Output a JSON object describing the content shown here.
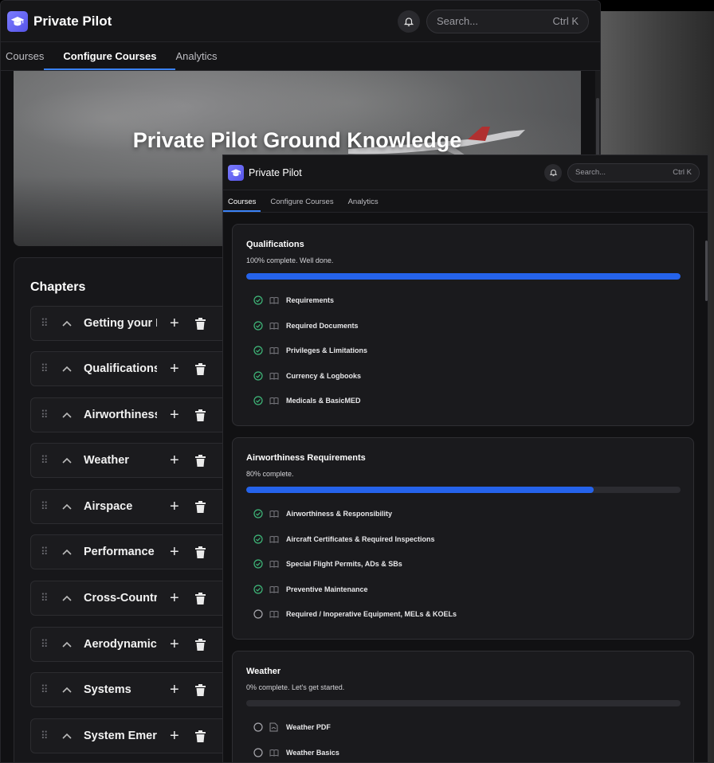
{
  "back_window": {
    "app_title": "Private Pilot",
    "search_placeholder": "Search...",
    "search_shortcut": "Ctrl K",
    "tabs": [
      {
        "label": "Courses",
        "active": false
      },
      {
        "label": "Configure Courses",
        "active": true
      },
      {
        "label": "Analytics",
        "active": false
      }
    ],
    "hero_title": "Private Pilot Ground Knowledge",
    "chapters_heading": "Chapters",
    "chapters": [
      "Getting your P",
      "Qualifications",
      "Airworthiness",
      "Weather",
      "Airspace",
      "Performance &",
      "Cross-Country",
      "Aerodynamics",
      "Systems",
      "System Emerg"
    ]
  },
  "front_window": {
    "app_title": "Private Pilot",
    "search_placeholder": "Search...",
    "search_shortcut": "Ctrl K",
    "tabs": [
      {
        "label": "Courses",
        "active": true
      },
      {
        "label": "Configure Courses",
        "active": false
      },
      {
        "label": "Analytics",
        "active": false
      }
    ],
    "courses": [
      {
        "title": "Qualifications",
        "status": "100% complete. Well done.",
        "progress_percent": 100,
        "lessons": [
          {
            "label": "Requirements",
            "done": true,
            "icon": "book-icon"
          },
          {
            "label": "Required Documents",
            "done": true,
            "icon": "book-icon"
          },
          {
            "label": "Privileges & Limitations",
            "done": true,
            "icon": "book-icon"
          },
          {
            "label": "Currency & Logbooks",
            "done": true,
            "icon": "book-icon"
          },
          {
            "label": "Medicals & BasicMED",
            "done": true,
            "icon": "book-icon"
          }
        ]
      },
      {
        "title": "Airworthiness Requirements",
        "status": "80% complete.",
        "progress_percent": 80,
        "lessons": [
          {
            "label": "Airworthiness & Responsibility",
            "done": true,
            "icon": "book-icon"
          },
          {
            "label": "Aircraft Certificates & Required Inspections",
            "done": true,
            "icon": "book-icon"
          },
          {
            "label": "Special Flight Permits, ADs & SBs",
            "done": true,
            "icon": "book-icon"
          },
          {
            "label": "Preventive Maintenance",
            "done": true,
            "icon": "book-icon"
          },
          {
            "label": "Required / Inoperative Equipment, MELs & KOELs",
            "done": false,
            "icon": "book-icon"
          }
        ]
      },
      {
        "title": "Weather",
        "status": "0% complete. Let's get started.",
        "progress_percent": 0,
        "lessons": [
          {
            "label": "Weather PDF",
            "done": false,
            "icon": "pdf-file-icon"
          },
          {
            "label": "Weather Basics",
            "done": false,
            "icon": "book-icon"
          }
        ]
      }
    ]
  },
  "colors": {
    "accent": "#2563eb",
    "done_green": "#3fb97a",
    "logo": "#6a68f5"
  }
}
